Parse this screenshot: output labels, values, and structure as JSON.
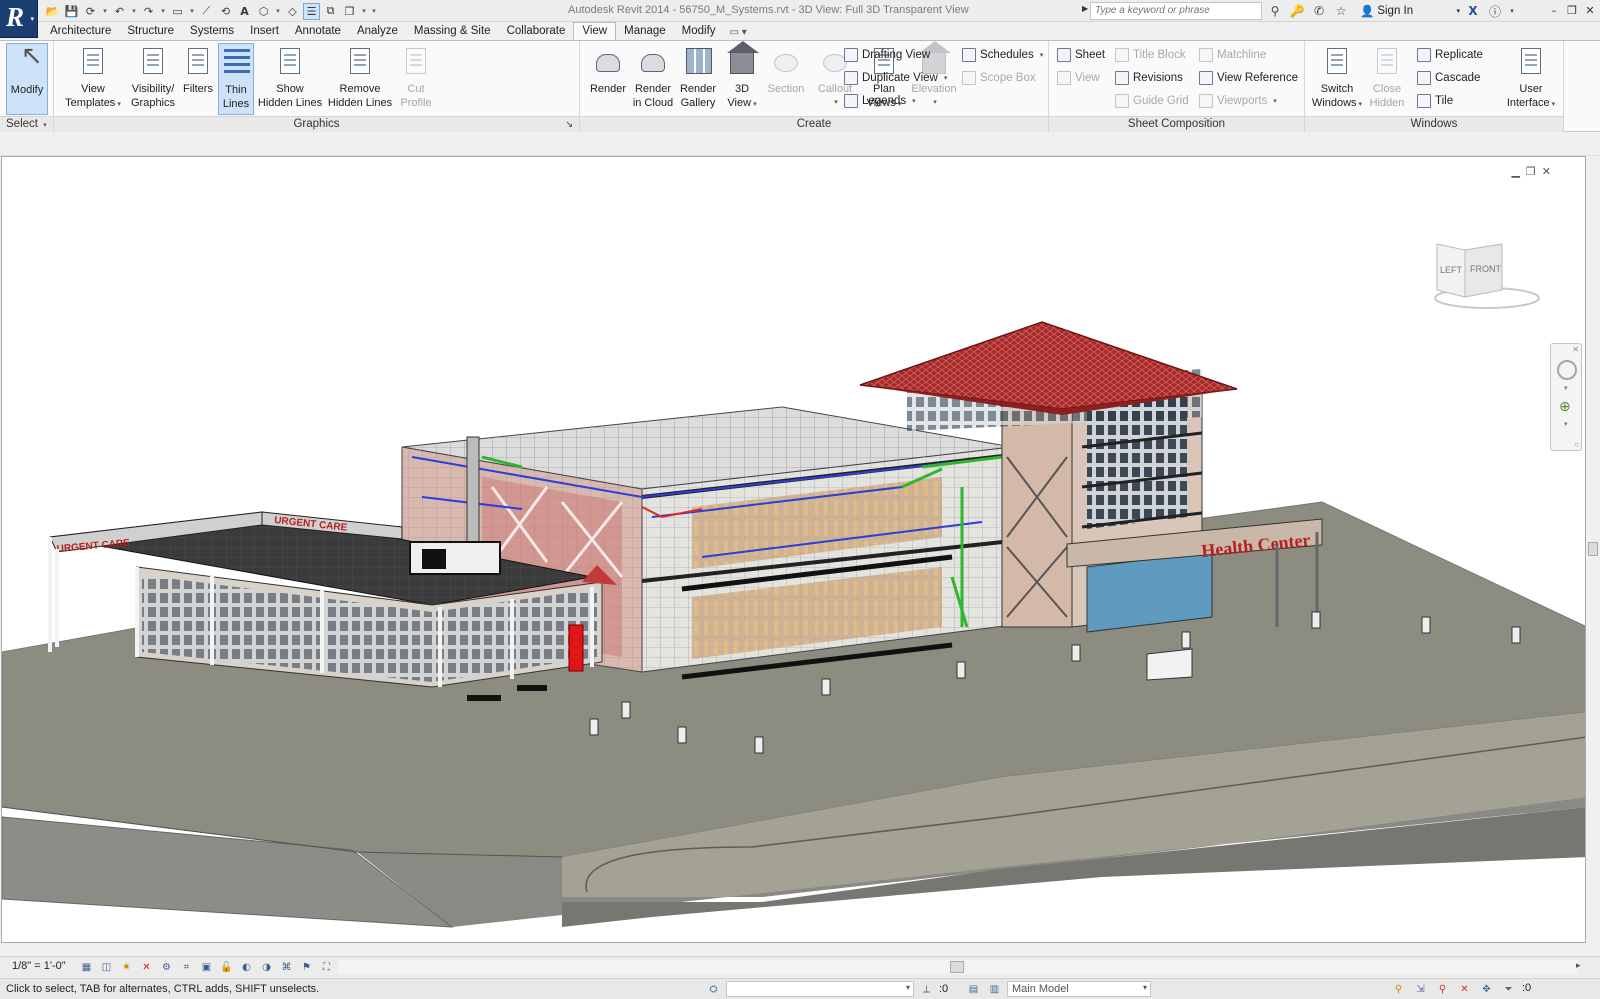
{
  "window": {
    "title": "Autodesk Revit 2014 -    56750_M_Systems.rvt - 3D View: Full 3D Transparent View",
    "search_placeholder": "Type a keyword or phrase",
    "sign_in": "Sign In"
  },
  "tabs": [
    "Architecture",
    "Structure",
    "Systems",
    "Insert",
    "Annotate",
    "Analyze",
    "Massing & Site",
    "Collaborate",
    "View",
    "Manage",
    "Modify"
  ],
  "active_tab": "View",
  "ribbon": {
    "select": {
      "modify": "Modify",
      "title": "Select"
    },
    "graphics": {
      "title": "Graphics",
      "view_templates": [
        "View",
        "Templates"
      ],
      "visibility_graphics": [
        "Visibility/",
        "Graphics"
      ],
      "filters": "Filters",
      "thin_lines": [
        "Thin",
        "Lines"
      ],
      "show_hidden": [
        "Show",
        "Hidden Lines"
      ],
      "remove_hidden": [
        "Remove",
        "Hidden Lines"
      ],
      "cut_profile": [
        "Cut",
        "Profile"
      ]
    },
    "create": {
      "title": "Create",
      "render": "Render",
      "render_cloud": [
        "Render",
        "in Cloud"
      ],
      "render_gallery": [
        "Render",
        "Gallery"
      ],
      "view3d": [
        "3D",
        "View"
      ],
      "section": "Section",
      "callout": "Callout",
      "plan_views": [
        "Plan",
        "Views"
      ],
      "elevation": "Elevation",
      "drafting_view": "Drafting  View",
      "duplicate_view": "Duplicate  View",
      "legends": "Legends",
      "schedules": "Schedules",
      "scope_box": "Scope  Box"
    },
    "sheet_composition": {
      "title": "Sheet Composition",
      "sheet": "Sheet",
      "view": "View",
      "title_block": "Title  Block",
      "revisions": "Revisions",
      "guide_grid": "Guide  Grid",
      "matchline": "Matchline",
      "view_reference": "View  Reference",
      "viewports": "Viewports"
    },
    "windows": {
      "title": "Windows",
      "switch_windows": [
        "Switch",
        "Windows"
      ],
      "close_hidden": [
        "Close",
        "Hidden"
      ],
      "replicate": "Replicate",
      "cascade": "Cascade",
      "tile": "Tile",
      "user_interface": [
        "User",
        "Interface"
      ]
    }
  },
  "viewcube": {
    "left": "LEFT",
    "front": "FRONT"
  },
  "scene": {
    "sign_health": "Health Center",
    "sign_urgent": "URGENT CARE"
  },
  "view_bar": {
    "scale": "1/8\" = 1'-0\""
  },
  "status": {
    "text": "Click to select, TAB for alternates, CTRL adds, SHIFT unselects.",
    "workset_count": ":0",
    "model": "Main Model",
    "filter_count": ":0"
  }
}
